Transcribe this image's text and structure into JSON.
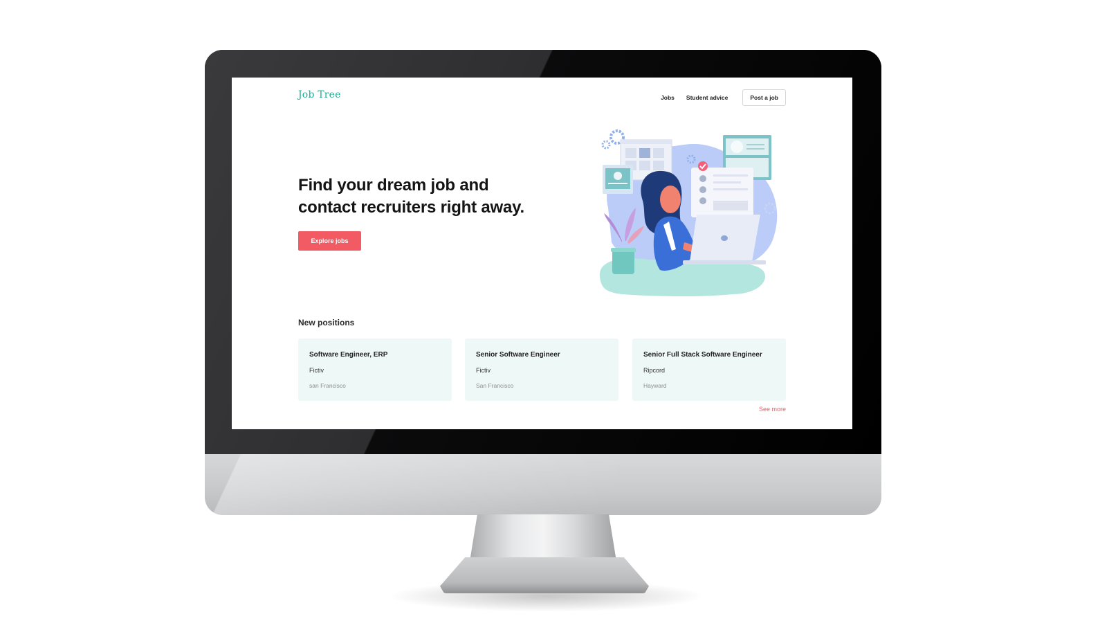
{
  "app": {
    "logo": "Job Tree",
    "brand_color": "#1cae96",
    "accent_color": "#f25a64"
  },
  "nav": {
    "jobs_label": "Jobs",
    "student_advice_label": "Student advice",
    "post_job_label": "Post a job"
  },
  "hero": {
    "headline_line1": "Find your dream job and",
    "headline_line2": "contact recruiters right away.",
    "cta_label": "Explore jobs",
    "illustration": "woman-working-on-laptop-illustration"
  },
  "positions": {
    "section_title": "New positions",
    "see_more_label": "See more",
    "items": [
      {
        "title": "Software Engineer, ERP",
        "company": "Fictiv",
        "location": "san Francisco"
      },
      {
        "title": "Senior Software Engineer",
        "company": "Fictiv",
        "location": "San Francisco"
      },
      {
        "title": "Senior Full Stack Software Engineer",
        "company": "Ripcord",
        "location": "Hayward"
      }
    ]
  }
}
